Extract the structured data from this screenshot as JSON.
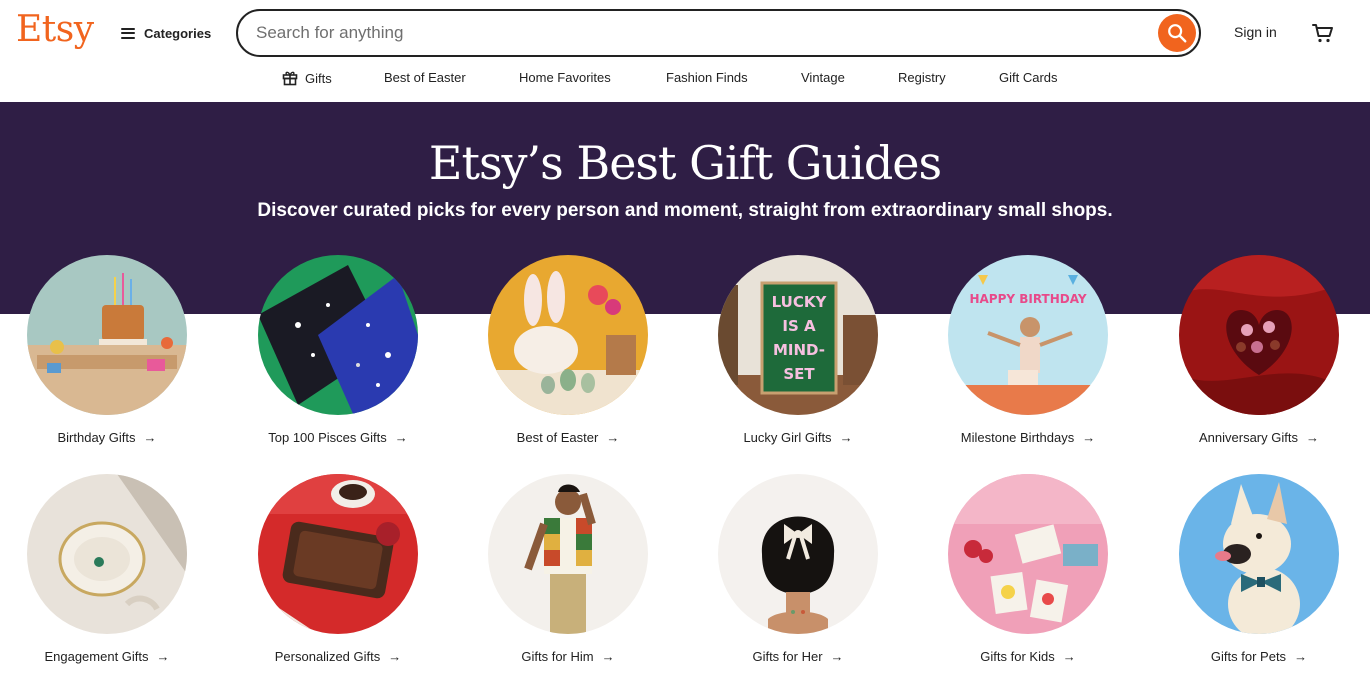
{
  "header": {
    "logo": "Etsy",
    "categories_label": "Categories",
    "search_placeholder": "Search for anything",
    "sign_in": "Sign in"
  },
  "subnav": {
    "items": [
      {
        "label": "Gifts",
        "icon": "gift-icon"
      },
      {
        "label": "Best of Easter"
      },
      {
        "label": "Home Favorites"
      },
      {
        "label": "Fashion Finds"
      },
      {
        "label": "Vintage"
      },
      {
        "label": "Registry"
      },
      {
        "label": "Gift Cards"
      }
    ]
  },
  "hero": {
    "title": "Etsy’s Best Gift Guides",
    "subtitle": "Discover curated picks for every person and moment, straight from extraordinary small shops."
  },
  "guides": [
    {
      "label": "Birthday Gifts",
      "arrow": "→"
    },
    {
      "label": "Top 100 Pisces Gifts",
      "arrow": "→"
    },
    {
      "label": "Best of Easter",
      "arrow": "→"
    },
    {
      "label": "Lucky Girl Gifts",
      "arrow": "→"
    },
    {
      "label": "Milestone Birthdays",
      "arrow": "→"
    },
    {
      "label": "Anniversary Gifts",
      "arrow": "→"
    },
    {
      "label": "Engagement Gifts",
      "arrow": "→"
    },
    {
      "label": "Personalized Gifts",
      "arrow": "→"
    },
    {
      "label": "Gifts for Him",
      "arrow": "→"
    },
    {
      "label": "Gifts for Her",
      "arrow": "→"
    },
    {
      "label": "Gifts for Kids",
      "arrow": "→"
    },
    {
      "label": "Gifts for Pets",
      "arrow": "→"
    }
  ],
  "art": {
    "poster_text": "LUCKY IS A MIND- SET",
    "banner_text": "HAPPY BIRTHDAY"
  },
  "colors": {
    "brand": "#f1641e",
    "hero_bg": "#2f1e45",
    "text": "#222222"
  }
}
